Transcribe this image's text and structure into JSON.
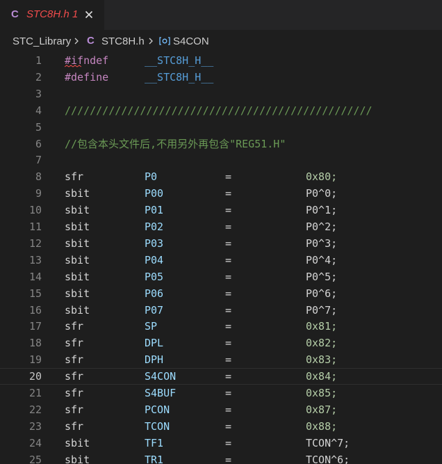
{
  "tab": {
    "lang_icon": "C",
    "title": "STC8H.h",
    "problem_count": "1",
    "close_icon": "close-icon"
  },
  "breadcrumb": {
    "folder": "STC_Library",
    "file_icon": "C",
    "file": "STC8H.h",
    "symbol": "S4CON",
    "symbol_icon": "symbol-constant-icon"
  },
  "code": {
    "current_line": 20,
    "lines": [
      {
        "n": "1",
        "kind": "pre",
        "a": "#ifndef",
        "b": "__STC8H_H__"
      },
      {
        "n": "2",
        "kind": "pre",
        "a": "#define",
        "b": "__STC8H_H__"
      },
      {
        "n": "3",
        "kind": "blank"
      },
      {
        "n": "4",
        "kind": "comment",
        "text": "/////////////////////////////////////////////////"
      },
      {
        "n": "5",
        "kind": "blank"
      },
      {
        "n": "6",
        "kind": "comment",
        "text": "//包含本头文件后,不用另外再包含\"REG51.H\""
      },
      {
        "n": "7",
        "kind": "blank"
      },
      {
        "n": "8",
        "kind": "decl",
        "type": "sfr",
        "name": "P0",
        "op": "=",
        "value": "0x80;"
      },
      {
        "n": "9",
        "kind": "decl",
        "type": "sbit",
        "name": "P00",
        "op": "=",
        "value": "P0^0;"
      },
      {
        "n": "10",
        "kind": "decl",
        "type": "sbit",
        "name": "P01",
        "op": "=",
        "value": "P0^1;"
      },
      {
        "n": "11",
        "kind": "decl",
        "type": "sbit",
        "name": "P02",
        "op": "=",
        "value": "P0^2;"
      },
      {
        "n": "12",
        "kind": "decl",
        "type": "sbit",
        "name": "P03",
        "op": "=",
        "value": "P0^3;"
      },
      {
        "n": "13",
        "kind": "decl",
        "type": "sbit",
        "name": "P04",
        "op": "=",
        "value": "P0^4;"
      },
      {
        "n": "14",
        "kind": "decl",
        "type": "sbit",
        "name": "P05",
        "op": "=",
        "value": "P0^5;"
      },
      {
        "n": "15",
        "kind": "decl",
        "type": "sbit",
        "name": "P06",
        "op": "=",
        "value": "P0^6;"
      },
      {
        "n": "16",
        "kind": "decl",
        "type": "sbit",
        "name": "P07",
        "op": "=",
        "value": "P0^7;"
      },
      {
        "n": "17",
        "kind": "decl",
        "type": "sfr",
        "name": "SP",
        "op": "=",
        "value": "0x81;"
      },
      {
        "n": "18",
        "kind": "decl",
        "type": "sfr",
        "name": "DPL",
        "op": "=",
        "value": "0x82;"
      },
      {
        "n": "19",
        "kind": "decl",
        "type": "sfr",
        "name": "DPH",
        "op": "=",
        "value": "0x83;"
      },
      {
        "n": "20",
        "kind": "decl",
        "type": "sfr",
        "name": "S4CON",
        "op": "=",
        "value": "0x84;"
      },
      {
        "n": "21",
        "kind": "decl",
        "type": "sfr",
        "name": "S4BUF",
        "op": "=",
        "value": "0x85;"
      },
      {
        "n": "22",
        "kind": "decl",
        "type": "sfr",
        "name": "PCON",
        "op": "=",
        "value": "0x87;"
      },
      {
        "n": "23",
        "kind": "decl",
        "type": "sfr",
        "name": "TCON",
        "op": "=",
        "value": "0x88;"
      },
      {
        "n": "24",
        "kind": "decl",
        "type": "sbit",
        "name": "TF1",
        "op": "=",
        "value": "TCON^7;"
      },
      {
        "n": "25",
        "kind": "decl",
        "type": "sbit",
        "name": "TR1",
        "op": "=",
        "value": "TCON^6;"
      }
    ]
  }
}
